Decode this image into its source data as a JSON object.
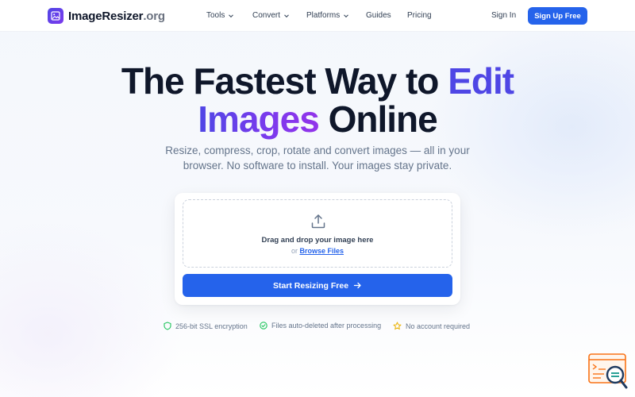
{
  "brand": {
    "name": "ImageResizer",
    "tld": ".org"
  },
  "nav": {
    "items": [
      {
        "label": "Tools",
        "has_dropdown": true
      },
      {
        "label": "Convert",
        "has_dropdown": true
      },
      {
        "label": "Platforms",
        "has_dropdown": true
      },
      {
        "label": "Guides",
        "has_dropdown": false
      },
      {
        "label": "Pricing",
        "has_dropdown": false
      }
    ],
    "signin_label": "Sign In",
    "signup_label": "Sign Up Free"
  },
  "hero": {
    "line1_a": "The Fastest Way to ",
    "line1_b": "Edit",
    "line2_a": "Images",
    "line2_b": " Online",
    "subtitle": "Resize, compress, crop, rotate and convert images — all in your browser. No software to install. Your images stay private."
  },
  "upload": {
    "icon": "upload-icon",
    "drop_text": "Drag and drop your image here",
    "or_text": "or",
    "browse_label": "Browse Files",
    "cta_label": "Start Resizing Free"
  },
  "trust": [
    {
      "icon": "shield-icon",
      "label": "256-bit SSL encryption",
      "color": "#22c55e"
    },
    {
      "icon": "check-circle-icon",
      "label": "Files auto-deleted after processing",
      "color": "#22c55e"
    },
    {
      "icon": "star-icon",
      "label": "No account required",
      "color": "#eab308"
    }
  ],
  "colors": {
    "primary": "#2563eb",
    "accent_purple": "#7c3aed",
    "text_dark": "#0f172a",
    "text_muted": "#64748b"
  }
}
